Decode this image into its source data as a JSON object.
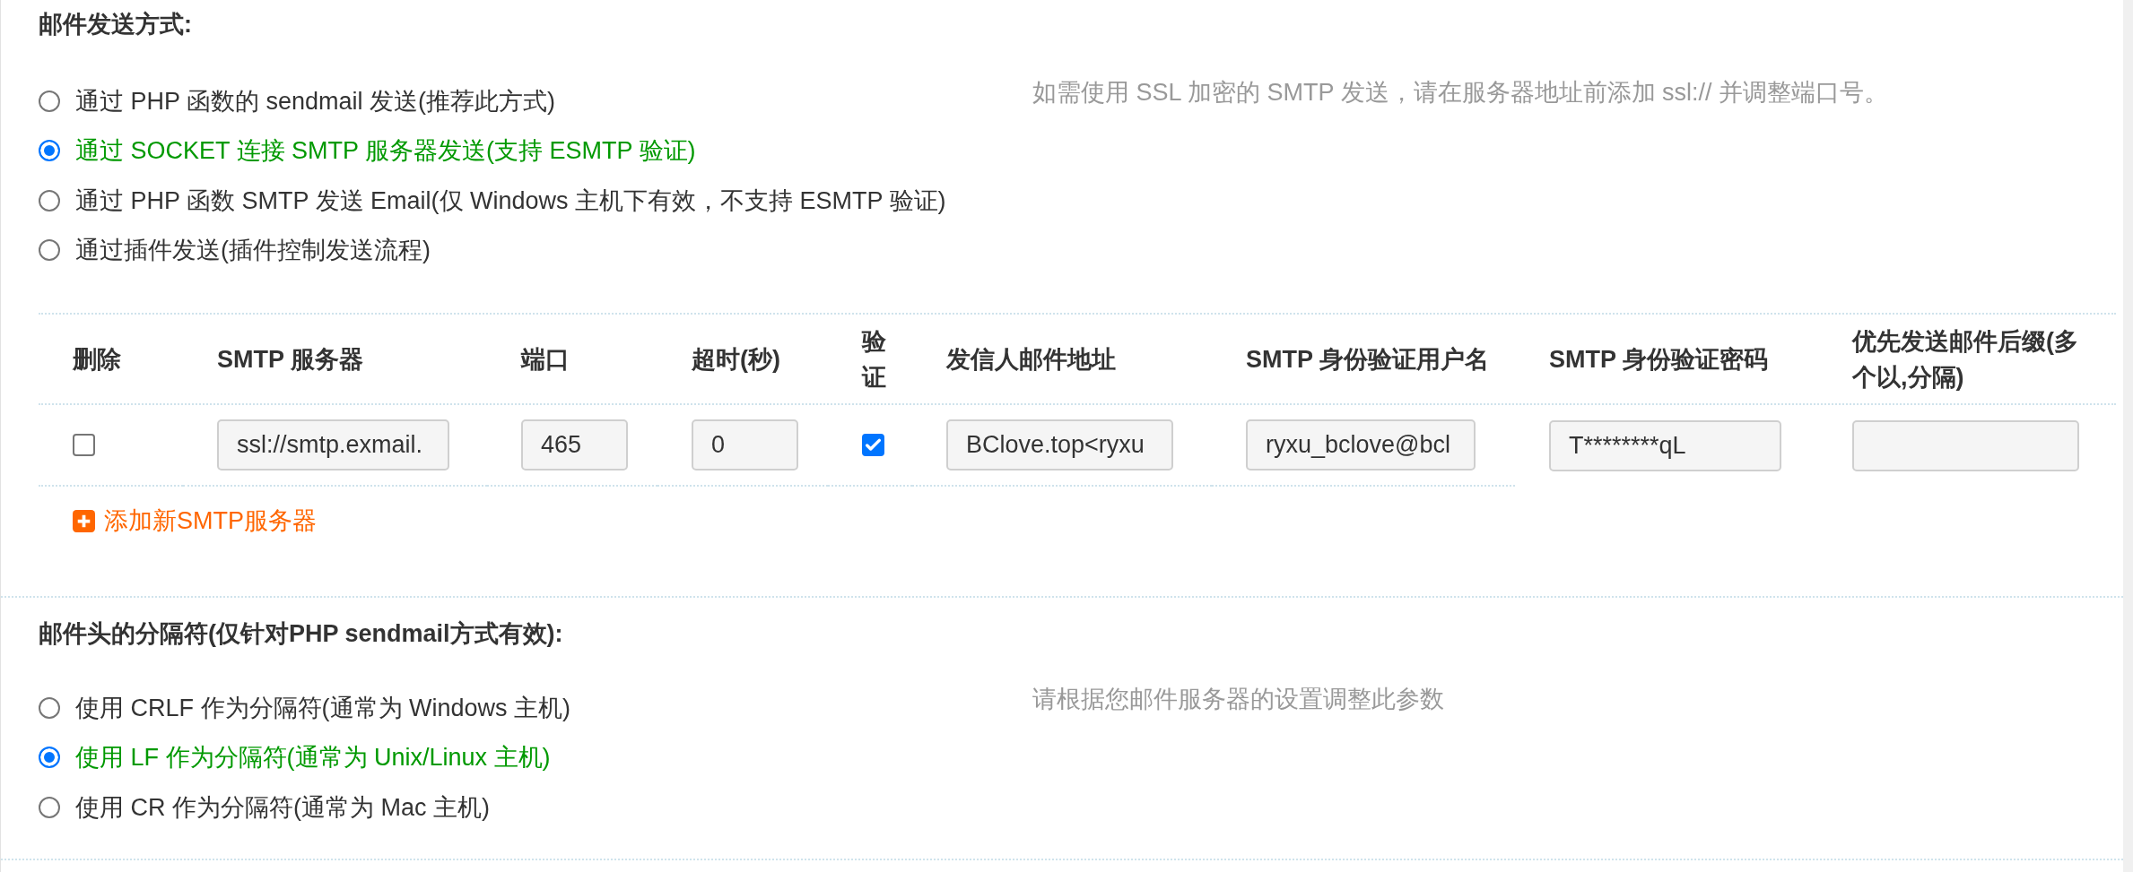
{
  "mail_method": {
    "title": "邮件发送方式:",
    "options": [
      {
        "label": "通过 PHP 函数的 sendmail 发送(推荐此方式)",
        "selected": false
      },
      {
        "label": "通过 SOCKET 连接 SMTP 服务器发送(支持 ESMTP 验证)",
        "selected": true
      },
      {
        "label": "通过 PHP 函数 SMTP 发送 Email(仅 Windows 主机下有效，不支持 ESMTP 验证)",
        "selected": false
      },
      {
        "label": "通过插件发送(插件控制发送流程)",
        "selected": false
      }
    ],
    "hint": "如需使用 SSL 加密的 SMTP 发送，请在服务器地址前添加 ssl:// 并调整端口号。"
  },
  "smtp_servers": {
    "columns": [
      "删除",
      "SMTP 服务器",
      "端口",
      "超时(秒)",
      "验证",
      "发信人邮件地址",
      "SMTP 身份验证用户名",
      "SMTP 身份验证密码",
      "优先发送邮件后缀(多个以,分隔)"
    ],
    "rows": [
      {
        "cells": [
          {
            "kind": "checkbox",
            "checked": false
          },
          {
            "kind": "text",
            "value": "ssl://smtp.exmail."
          },
          {
            "kind": "text",
            "value": "465"
          },
          {
            "kind": "text",
            "value": "0"
          },
          {
            "kind": "checkbox",
            "checked": true
          },
          {
            "kind": "text",
            "value": "BClove.top<ryxu"
          },
          {
            "kind": "text",
            "value": "ryxu_bclove@bcl"
          },
          {
            "kind": "text",
            "value": "T********qL"
          },
          {
            "kind": "text"
          }
        ]
      }
    ],
    "add_link": "添加新SMTP服务器"
  },
  "header_separator": {
    "title": "邮件头的分隔符(仅针对PHP sendmail方式有效):",
    "options": [
      {
        "label": "使用 CRLF 作为分隔符(通常为 Windows 主机)",
        "selected": false
      },
      {
        "label": "使用 LF 作为分隔符(通常为 Unix/Linux 主机)",
        "selected": true
      },
      {
        "label": "使用 CR 作为分隔符(通常为 Mac 主机)",
        "selected": false
      }
    ],
    "hint": "请根据您邮件服务器的设置调整此参数"
  }
}
